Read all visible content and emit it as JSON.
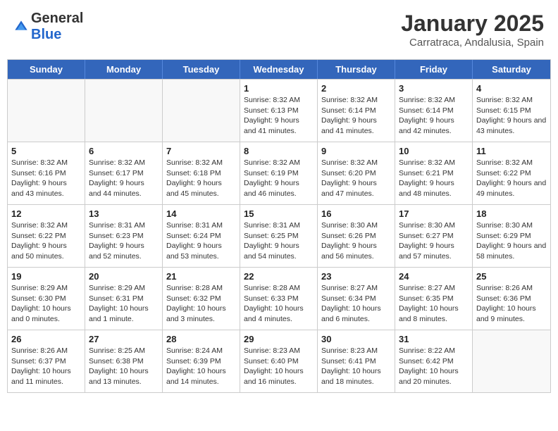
{
  "header": {
    "logo": {
      "text_general": "General",
      "text_blue": "Blue"
    },
    "title": "January 2025",
    "subtitle": "Carratraca, Andalusia, Spain"
  },
  "calendar": {
    "days_of_week": [
      "Sunday",
      "Monday",
      "Tuesday",
      "Wednesday",
      "Thursday",
      "Friday",
      "Saturday"
    ],
    "weeks": [
      [
        {
          "day": "",
          "info": ""
        },
        {
          "day": "",
          "info": ""
        },
        {
          "day": "",
          "info": ""
        },
        {
          "day": "1",
          "info": "Sunrise: 8:32 AM\nSunset: 6:13 PM\nDaylight: 9 hours and 41 minutes."
        },
        {
          "day": "2",
          "info": "Sunrise: 8:32 AM\nSunset: 6:14 PM\nDaylight: 9 hours and 41 minutes."
        },
        {
          "day": "3",
          "info": "Sunrise: 8:32 AM\nSunset: 6:14 PM\nDaylight: 9 hours and 42 minutes."
        },
        {
          "day": "4",
          "info": "Sunrise: 8:32 AM\nSunset: 6:15 PM\nDaylight: 9 hours and 43 minutes."
        }
      ],
      [
        {
          "day": "5",
          "info": "Sunrise: 8:32 AM\nSunset: 6:16 PM\nDaylight: 9 hours and 43 minutes."
        },
        {
          "day": "6",
          "info": "Sunrise: 8:32 AM\nSunset: 6:17 PM\nDaylight: 9 hours and 44 minutes."
        },
        {
          "day": "7",
          "info": "Sunrise: 8:32 AM\nSunset: 6:18 PM\nDaylight: 9 hours and 45 minutes."
        },
        {
          "day": "8",
          "info": "Sunrise: 8:32 AM\nSunset: 6:19 PM\nDaylight: 9 hours and 46 minutes."
        },
        {
          "day": "9",
          "info": "Sunrise: 8:32 AM\nSunset: 6:20 PM\nDaylight: 9 hours and 47 minutes."
        },
        {
          "day": "10",
          "info": "Sunrise: 8:32 AM\nSunset: 6:21 PM\nDaylight: 9 hours and 48 minutes."
        },
        {
          "day": "11",
          "info": "Sunrise: 8:32 AM\nSunset: 6:22 PM\nDaylight: 9 hours and 49 minutes."
        }
      ],
      [
        {
          "day": "12",
          "info": "Sunrise: 8:32 AM\nSunset: 6:22 PM\nDaylight: 9 hours and 50 minutes."
        },
        {
          "day": "13",
          "info": "Sunrise: 8:31 AM\nSunset: 6:23 PM\nDaylight: 9 hours and 52 minutes."
        },
        {
          "day": "14",
          "info": "Sunrise: 8:31 AM\nSunset: 6:24 PM\nDaylight: 9 hours and 53 minutes."
        },
        {
          "day": "15",
          "info": "Sunrise: 8:31 AM\nSunset: 6:25 PM\nDaylight: 9 hours and 54 minutes."
        },
        {
          "day": "16",
          "info": "Sunrise: 8:30 AM\nSunset: 6:26 PM\nDaylight: 9 hours and 56 minutes."
        },
        {
          "day": "17",
          "info": "Sunrise: 8:30 AM\nSunset: 6:27 PM\nDaylight: 9 hours and 57 minutes."
        },
        {
          "day": "18",
          "info": "Sunrise: 8:30 AM\nSunset: 6:29 PM\nDaylight: 9 hours and 58 minutes."
        }
      ],
      [
        {
          "day": "19",
          "info": "Sunrise: 8:29 AM\nSunset: 6:30 PM\nDaylight: 10 hours and 0 minutes."
        },
        {
          "day": "20",
          "info": "Sunrise: 8:29 AM\nSunset: 6:31 PM\nDaylight: 10 hours and 1 minute."
        },
        {
          "day": "21",
          "info": "Sunrise: 8:28 AM\nSunset: 6:32 PM\nDaylight: 10 hours and 3 minutes."
        },
        {
          "day": "22",
          "info": "Sunrise: 8:28 AM\nSunset: 6:33 PM\nDaylight: 10 hours and 4 minutes."
        },
        {
          "day": "23",
          "info": "Sunrise: 8:27 AM\nSunset: 6:34 PM\nDaylight: 10 hours and 6 minutes."
        },
        {
          "day": "24",
          "info": "Sunrise: 8:27 AM\nSunset: 6:35 PM\nDaylight: 10 hours and 8 minutes."
        },
        {
          "day": "25",
          "info": "Sunrise: 8:26 AM\nSunset: 6:36 PM\nDaylight: 10 hours and 9 minutes."
        }
      ],
      [
        {
          "day": "26",
          "info": "Sunrise: 8:26 AM\nSunset: 6:37 PM\nDaylight: 10 hours and 11 minutes."
        },
        {
          "day": "27",
          "info": "Sunrise: 8:25 AM\nSunset: 6:38 PM\nDaylight: 10 hours and 13 minutes."
        },
        {
          "day": "28",
          "info": "Sunrise: 8:24 AM\nSunset: 6:39 PM\nDaylight: 10 hours and 14 minutes."
        },
        {
          "day": "29",
          "info": "Sunrise: 8:23 AM\nSunset: 6:40 PM\nDaylight: 10 hours and 16 minutes."
        },
        {
          "day": "30",
          "info": "Sunrise: 8:23 AM\nSunset: 6:41 PM\nDaylight: 10 hours and 18 minutes."
        },
        {
          "day": "31",
          "info": "Sunrise: 8:22 AM\nSunset: 6:42 PM\nDaylight: 10 hours and 20 minutes."
        },
        {
          "day": "",
          "info": ""
        }
      ]
    ]
  }
}
